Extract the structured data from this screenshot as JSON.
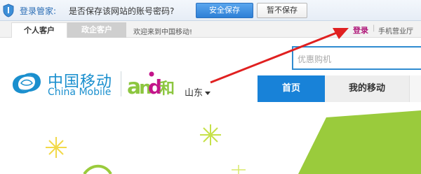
{
  "password_bar": {
    "title": "登录管家:",
    "question": "是否保存该网站的账号密码?",
    "save_label": "安全保存",
    "nosave_label": "暂不保存",
    "icon": "shield-icon"
  },
  "topnav": {
    "tabs": [
      {
        "label": "个人客户",
        "active": true
      },
      {
        "label": "政企客户",
        "active": false
      }
    ],
    "welcome": "欢迎来到中国移动!",
    "login": "登录",
    "separator": "|",
    "mobile_hall": "手机营业厅"
  },
  "header": {
    "search_placeholder": "优惠购机",
    "logo_cn": "中国移动",
    "logo_en": "China Mobile",
    "and_text": "和",
    "province": "山东"
  },
  "mainnav": {
    "items": [
      {
        "label": "首页",
        "active": true
      },
      {
        "label": "我的移动",
        "active": false
      }
    ]
  },
  "colors": {
    "brand_blue": "#1a8fce",
    "nav_blue": "#1882d8",
    "and_green": "#8cc63f",
    "and_magenta": "#c3158a",
    "annotation_red": "#e02020"
  }
}
